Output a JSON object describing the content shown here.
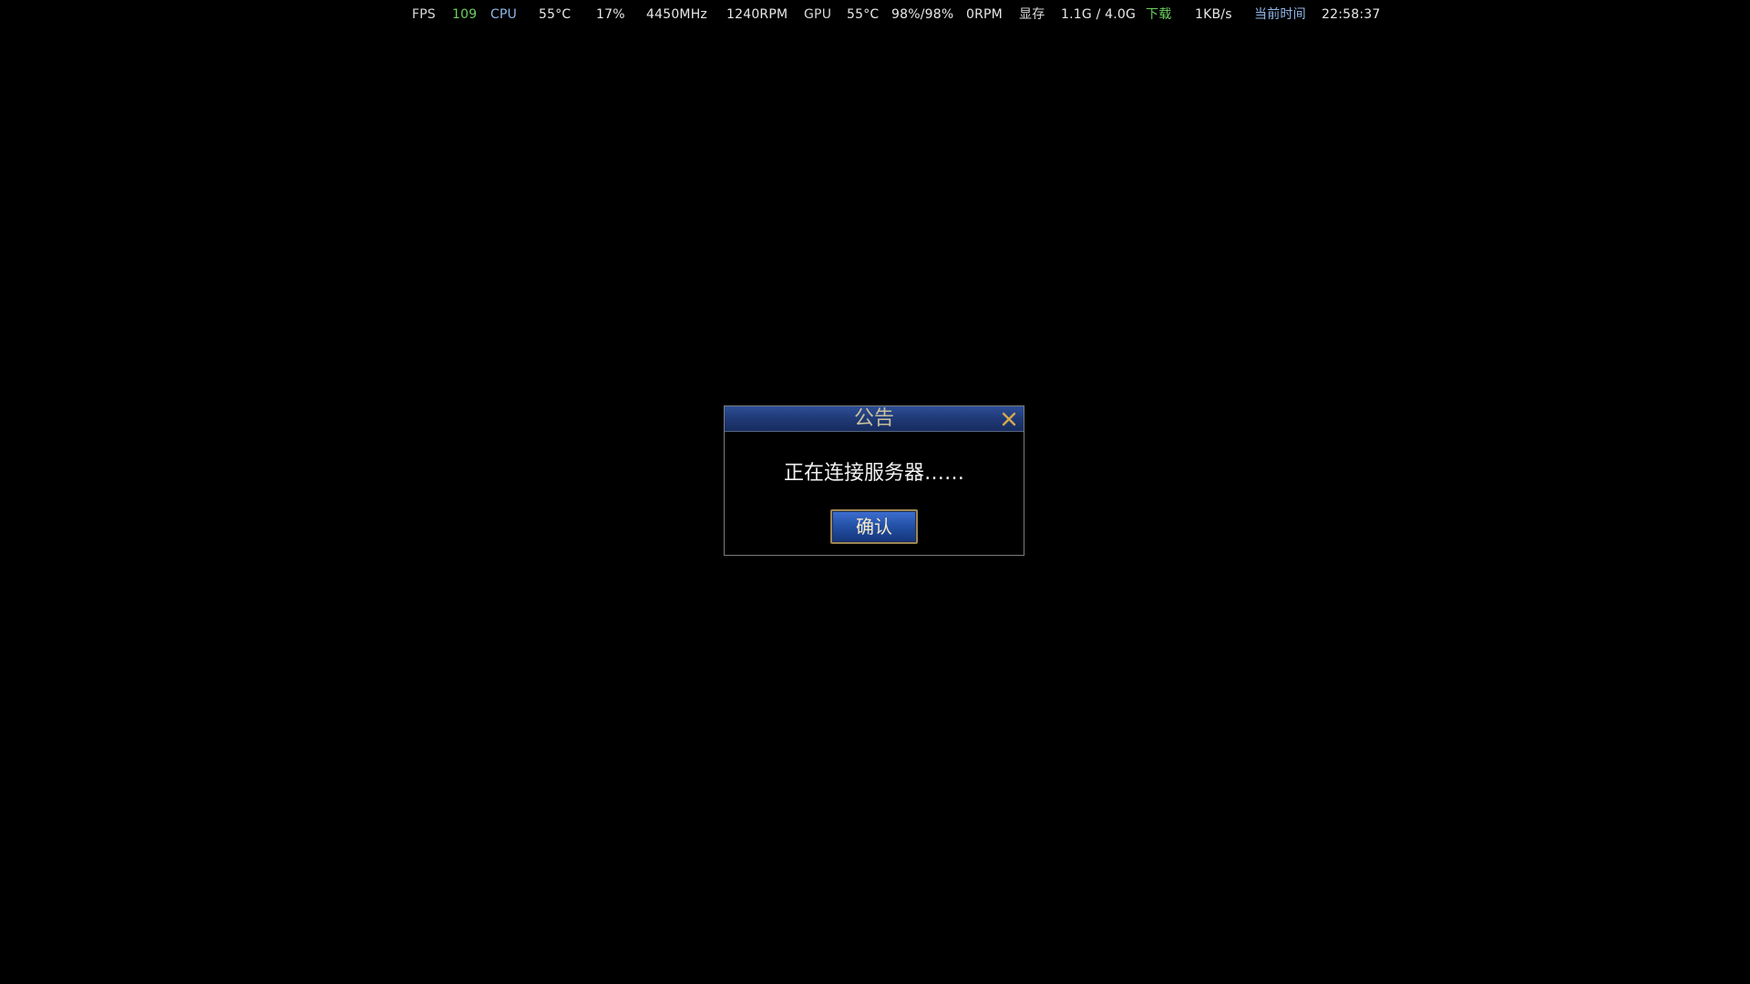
{
  "hud": {
    "fps_label": "FPS",
    "fps_value": "109",
    "cpu_label": "CPU",
    "cpu_temp": "55°C",
    "cpu_usage": "17%",
    "cpu_clock": "4450MHz",
    "cpu_fan": "1240RPM",
    "gpu_label": "GPU",
    "gpu_temp": "55°C",
    "gpu_usage": "98%/98%",
    "gpu_fan": "0RPM",
    "vram_label": "显存",
    "vram_value": "1.1G / 4.0G",
    "download_label": "下载",
    "download_value": "1KB/s",
    "time_label": "当前时间",
    "time_value": "22:58:37"
  },
  "dialog": {
    "title": "公告",
    "message": "正在连接服务器……",
    "confirm_label": "确认"
  },
  "colors": {
    "hud_green": "#6ccf5e",
    "hud_blue": "#8fb6e8",
    "dialog_header": "#203b79",
    "button_blue": "#2452a8",
    "button_border": "#9c8654",
    "close_icon": "#d6a74d"
  },
  "icons": {
    "close": "close-icon"
  }
}
